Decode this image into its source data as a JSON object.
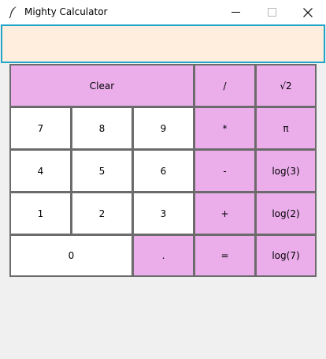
{
  "window": {
    "title": "Mighty Calculator",
    "minimize_glyph": "—",
    "maximize_glyph": "☐",
    "close_glyph": "✕"
  },
  "display": {
    "value": ""
  },
  "colors": {
    "operator_bg": "#ebaeeb",
    "digit_bg": "#ffffff",
    "display_bg": "#ffeedd",
    "display_border": "#1ea5c9"
  },
  "buttons": {
    "clear": "Clear",
    "divide": "/",
    "sqrt2": "√2",
    "seven": "7",
    "eight": "8",
    "nine": "9",
    "multiply": "*",
    "pi": "π",
    "four": "4",
    "five": "5",
    "six": "6",
    "minus": "-",
    "log3": "log(3)",
    "one": "1",
    "two": "2",
    "three": "3",
    "plus": "+",
    "log2": "log(2)",
    "zero": "0",
    "dot": ".",
    "equals": "=",
    "log7": "log(7)"
  }
}
